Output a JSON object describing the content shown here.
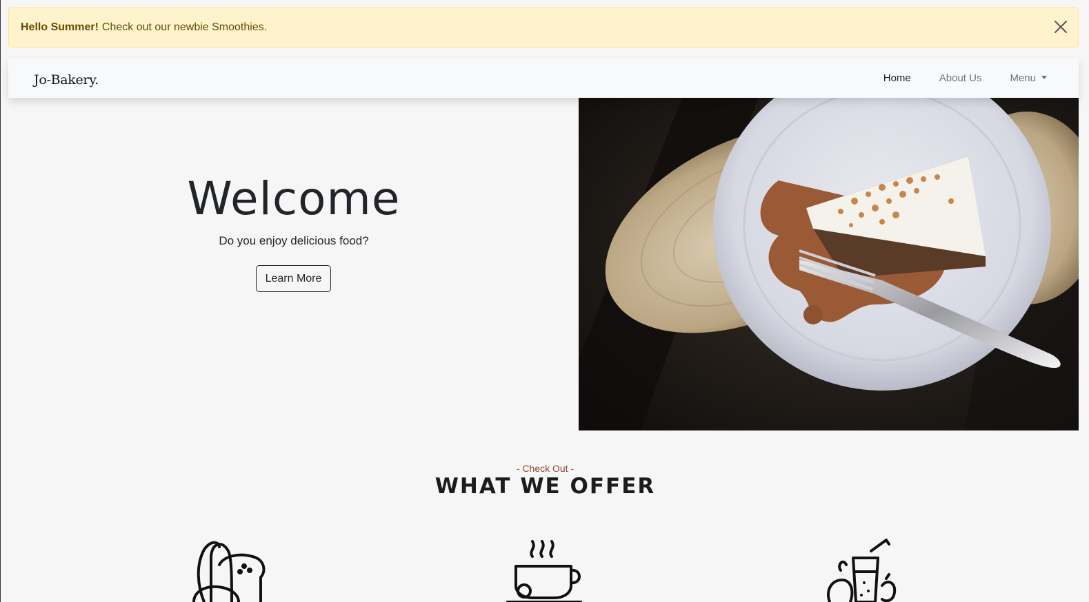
{
  "alert": {
    "strong_text": "Hello Summer!",
    "message": "Check out our newbie Smoothies.",
    "close_icon": "close-icon",
    "bg_color": "#fff3cd",
    "text_color": "#664d03"
  },
  "navbar": {
    "brand": "Jo-Bakery.",
    "links": [
      {
        "label": "Home",
        "active": true
      },
      {
        "label": "About Us",
        "active": false
      },
      {
        "label": "Menu",
        "active": false,
        "dropdown": true
      }
    ]
  },
  "hero": {
    "title": "Welcome",
    "subtitle": "Do you enjoy delicious food?",
    "button_label": "Learn More",
    "image_subject": "slice of carrot cake with caramel sauce and fork on white plate"
  },
  "offers": {
    "eyebrow": "- Check Out -",
    "title": "WHAT WE OFFER",
    "icons": [
      "bread-icon",
      "coffee-cup-icon",
      "smoothie-icon"
    ]
  }
}
